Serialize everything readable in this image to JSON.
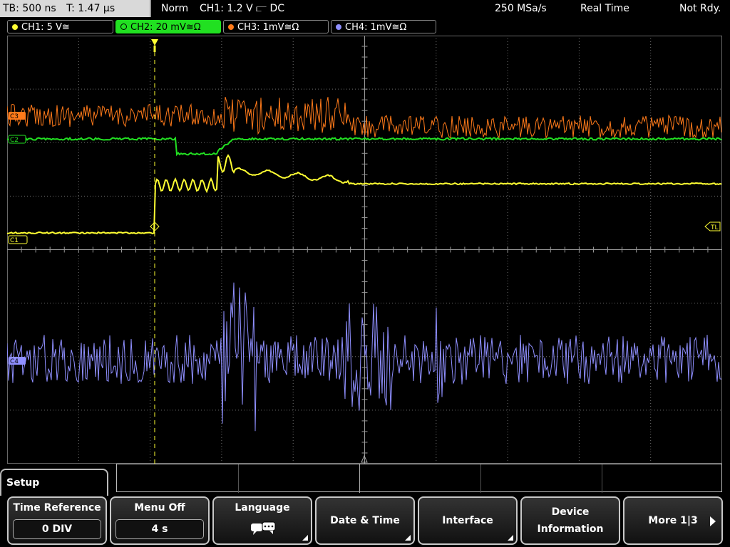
{
  "status": {
    "timebase": "TB: 500 ns",
    "trigger_time": "T: 1.47 µs",
    "mode": "Norm",
    "trigger": "CH1: 1.2 V ⫍ DC",
    "sample_rate": "250 MSa/s",
    "acq_mode": "Real Time",
    "state": "Not Rdy."
  },
  "channels": [
    {
      "label": "CH1: 5 V≅",
      "color": "#ffff33"
    },
    {
      "label": "CH2: 20 mV≅Ω",
      "color": "#22e022"
    },
    {
      "label": "CH3: 1mV≅Ω",
      "color": "#ff7a1a"
    },
    {
      "label": "CH4: 1mV≅Ω",
      "color": "#8f8fff"
    }
  ],
  "markers": {
    "ch1": "C1",
    "ch2": "C2",
    "ch3": "C3",
    "ch4": "C4",
    "trigger_level": "TL"
  },
  "menu": {
    "title": "Setup",
    "buttons": [
      {
        "label": "Time Reference",
        "value": "0 DIV"
      },
      {
        "label": "Menu Off",
        "value": "4 s"
      },
      {
        "label": "Language",
        "icon": "speech-bubble-icon"
      },
      {
        "label": "Date & Time"
      },
      {
        "label": "Interface"
      },
      {
        "label": "Device",
        "label2": "Information"
      },
      {
        "label": "More 1|3"
      }
    ]
  },
  "colors": {
    "grid": "#6e6e6e",
    "ch1": "#ffff33",
    "ch2": "#22e022",
    "ch3": "#ff7a1a",
    "ch4": "#8f8fff",
    "trigger": "#ffff33"
  }
}
